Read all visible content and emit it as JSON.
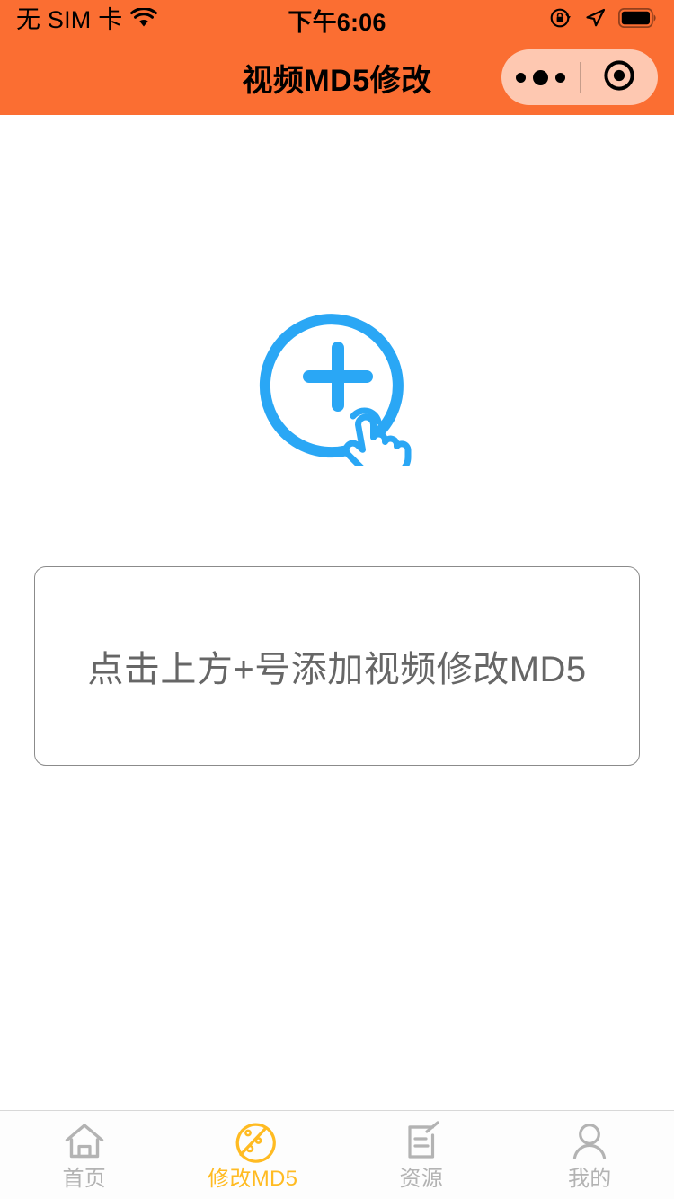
{
  "theme": {
    "header_bg": "#fb6e32",
    "accent_blue": "#2aa7f5",
    "tab_active": "#ffbb22",
    "tab_inactive": "#b3b3b3",
    "hint_text": "#666666",
    "hint_border": "#8b8b8b"
  },
  "status_bar": {
    "carrier": "无 SIM 卡",
    "wifi_icon": "wifi-icon",
    "time": "下午6:06",
    "rotation_lock_icon": "rotation-lock-icon",
    "location_icon": "location-arrow-icon",
    "battery_icon": "battery-full-icon"
  },
  "nav_bar": {
    "title": "视频MD5修改",
    "capsule": {
      "menu_icon": "more-dots-icon",
      "target_icon": "target-circle-icon"
    }
  },
  "main": {
    "add_button": {
      "icon": "add-circle-tap-icon",
      "label": ""
    },
    "hint": {
      "text": "点击上方+号添加视频修改MD5"
    }
  },
  "tab_bar": {
    "active_index": 1,
    "items": [
      {
        "label": "首页",
        "icon": "home-icon",
        "active": false
      },
      {
        "label": "修改MD5",
        "icon": "palette-icon",
        "active": true
      },
      {
        "label": "资源",
        "icon": "document-pen-icon",
        "active": false
      },
      {
        "label": "我的",
        "icon": "person-icon",
        "active": false
      }
    ]
  }
}
